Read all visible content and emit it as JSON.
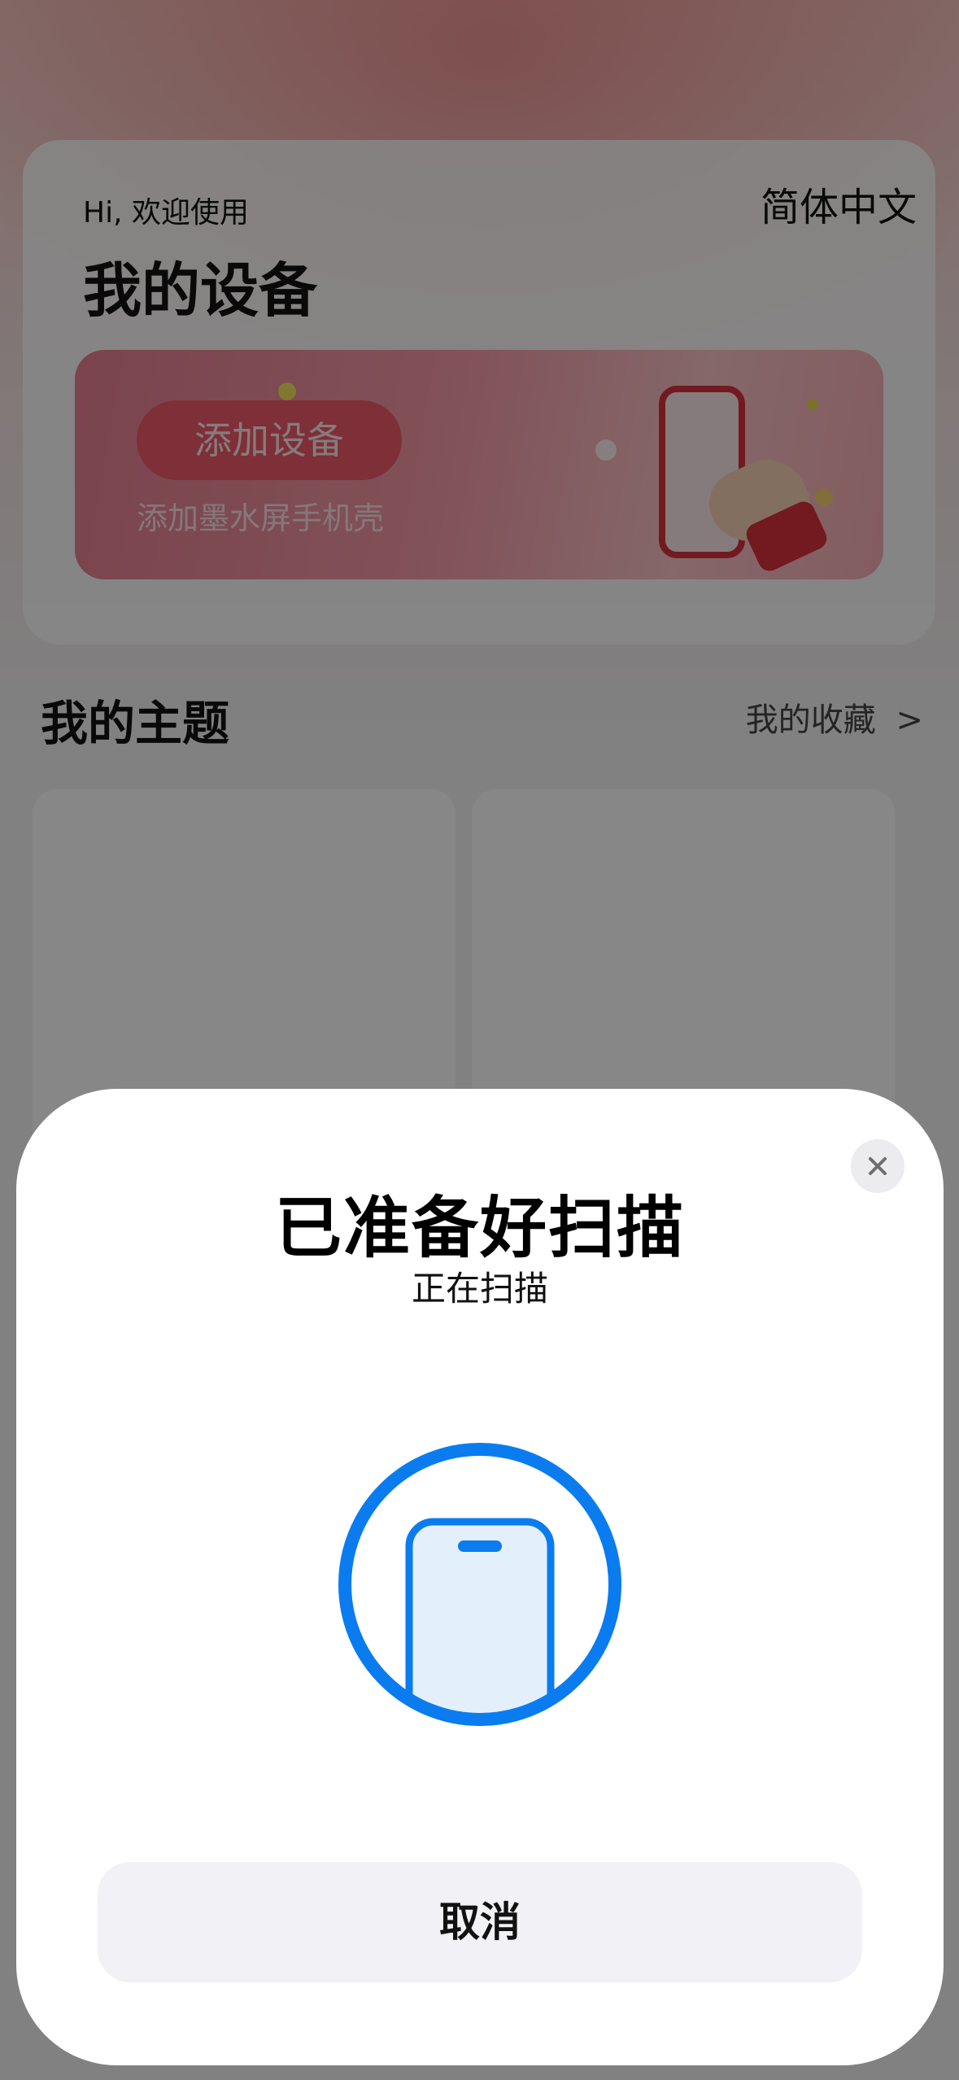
{
  "background_app": {
    "greeting": "Hi, 欢迎使用",
    "language": "简体中文",
    "device_title": "我的设备",
    "banner": {
      "button_label": "添加设备",
      "subtitle": "添加墨水屏手机壳"
    },
    "themes_title": "我的主题",
    "favorites_link": "我的收藏",
    "favorites_chevron": ">"
  },
  "nfc_sheet": {
    "title": "已准备好扫描",
    "subtitle": "正在扫描",
    "cancel_label": "取消",
    "close_icon": "close-icon",
    "graphic_icon": "phone-in-circle-icon",
    "accent_color": "#0a7cf0",
    "phone_fill_color": "#e3f0fc"
  }
}
